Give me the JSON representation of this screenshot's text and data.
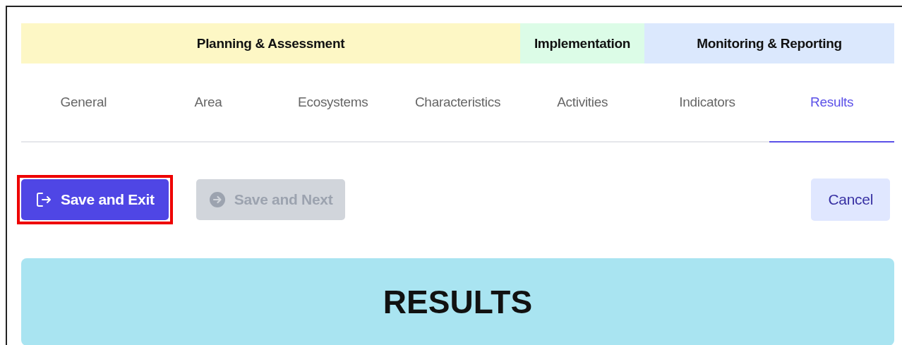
{
  "phases": [
    {
      "label": "Planning & Assessment",
      "color": "#fdf7c5"
    },
    {
      "label": "Implementation",
      "color": "#dcfce7"
    },
    {
      "label": "Monitoring & Reporting",
      "color": "#dbe8fd"
    }
  ],
  "tabs": [
    {
      "label": "General",
      "selected": false
    },
    {
      "label": "Area",
      "selected": false
    },
    {
      "label": "Ecosystems",
      "selected": false
    },
    {
      "label": "Characteristics",
      "selected": false
    },
    {
      "label": "Activities",
      "selected": false
    },
    {
      "label": "Indicators",
      "selected": false
    },
    {
      "label": "Results",
      "selected": true
    }
  ],
  "actions": [
    {
      "label": "Save and Exit",
      "kind": "exit",
      "disabled": false,
      "highlighted": true
    },
    {
      "label": "Save and Next",
      "kind": "next",
      "disabled": true,
      "highlighted": false
    },
    {
      "label": "Cancel",
      "kind": "cancel",
      "disabled": false,
      "highlighted": false
    }
  ],
  "section": {
    "title": "RESULTS"
  }
}
